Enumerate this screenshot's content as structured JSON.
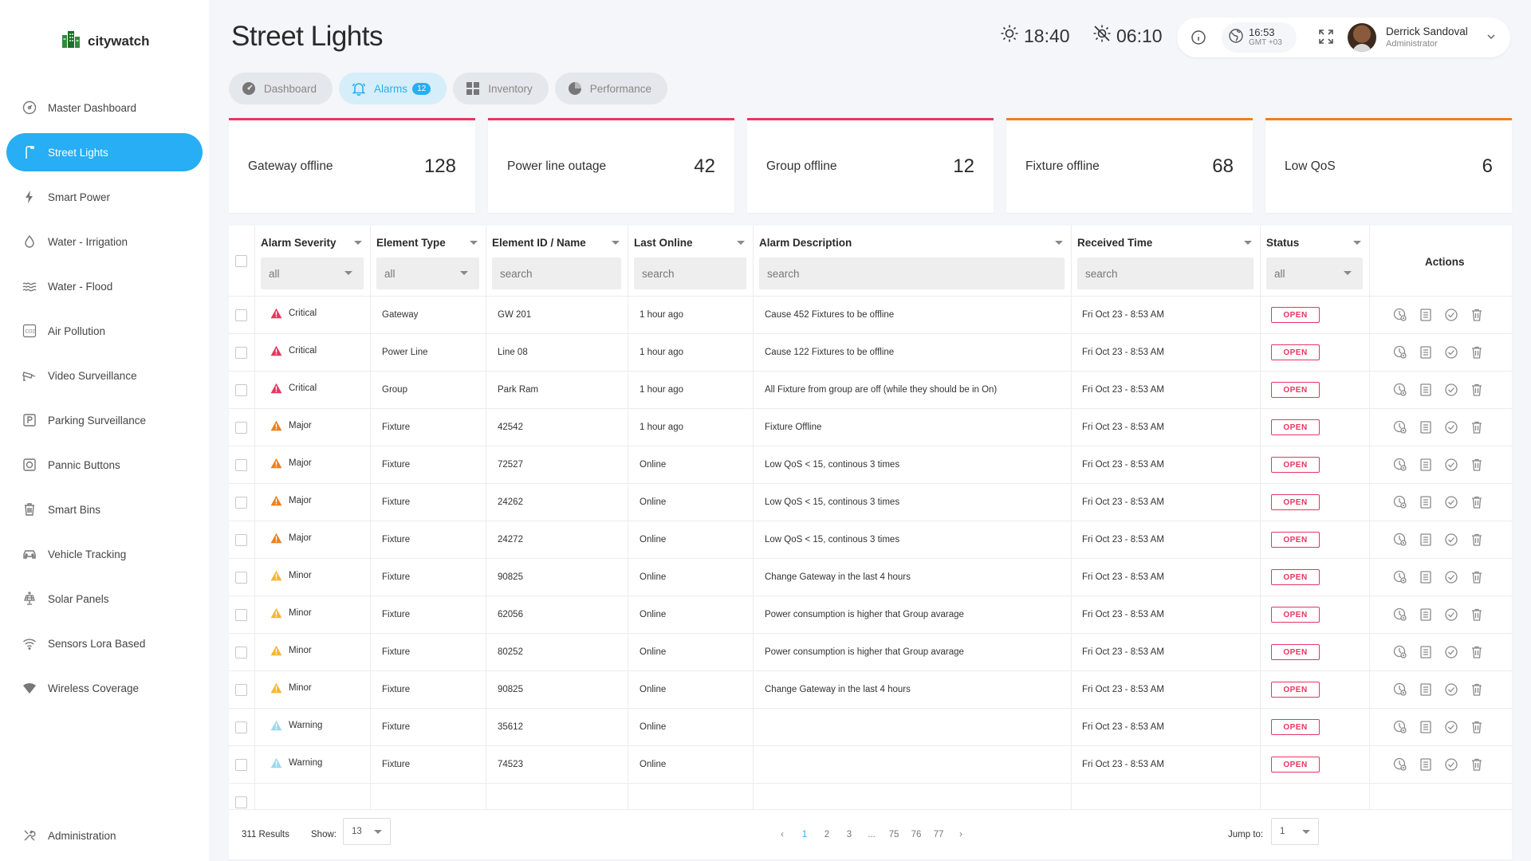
{
  "app": {
    "name": "citywatch"
  },
  "sidebar": {
    "items": [
      {
        "label": "Master Dashboard",
        "icon": "dashboard-icon",
        "active": false
      },
      {
        "label": "Street Lights",
        "icon": "street-light-icon",
        "active": true
      },
      {
        "label": "Smart Power",
        "icon": "lightning-icon",
        "active": false
      },
      {
        "label": "Water - Irrigation",
        "icon": "water-drop-icon",
        "active": false
      },
      {
        "label": "Water - Flood",
        "icon": "wave-icon",
        "active": false
      },
      {
        "label": "Air Pollution",
        "icon": "co2-icon",
        "active": false
      },
      {
        "label": "Video Surveillance",
        "icon": "camera-icon",
        "active": false
      },
      {
        "label": "Parking Surveillance",
        "icon": "parking-icon",
        "active": false
      },
      {
        "label": "Pannic Buttons",
        "icon": "panic-button-icon",
        "active": false
      },
      {
        "label": "Smart Bins",
        "icon": "bin-icon",
        "active": false
      },
      {
        "label": "Vehicle Tracking",
        "icon": "car-icon",
        "active": false
      },
      {
        "label": "Solar Panels",
        "icon": "solar-panel-icon",
        "active": false
      },
      {
        "label": "Sensors Lora Based",
        "icon": "signal-icon",
        "active": false
      },
      {
        "label": "Wireless Coverage",
        "icon": "wifi-icon",
        "active": false
      }
    ],
    "bottom": {
      "label": "Administration",
      "icon": "tools-icon"
    }
  },
  "header": {
    "title": "Street Lights",
    "sunrise": "18:40",
    "sunset": "06:10",
    "clock": {
      "time": "16:53",
      "tz": "GMT +03"
    },
    "user": {
      "name": "Derrick Sandoval",
      "role": "Administrator"
    }
  },
  "tabs": [
    {
      "label": "Dashboard",
      "icon": "gauge-icon",
      "active": false,
      "badge": ""
    },
    {
      "label": "Alarms",
      "icon": "bell-icon",
      "active": true,
      "badge": "12"
    },
    {
      "label": "Inventory",
      "icon": "grid-icon",
      "active": false,
      "badge": ""
    },
    {
      "label": "Performance",
      "icon": "pie-icon",
      "active": false,
      "badge": ""
    }
  ],
  "kpis": [
    {
      "label": "Gateway offline",
      "value": "128",
      "color": "#e8355f"
    },
    {
      "label": "Power line outage",
      "value": "42",
      "color": "#e8355f"
    },
    {
      "label": "Group offline",
      "value": "12",
      "color": "#e8355f"
    },
    {
      "label": "Fixture offline",
      "value": "68",
      "color": "#f07f1a"
    },
    {
      "label": "Low QoS",
      "value": "6",
      "color": "#f07f1a"
    }
  ],
  "table": {
    "columns": [
      {
        "label": "Alarm Severity",
        "filter": "all",
        "type": "select"
      },
      {
        "label": "Element Type",
        "filter": "all",
        "type": "select"
      },
      {
        "label": "Element ID / Name",
        "filter": "search",
        "type": "input"
      },
      {
        "label": "Last Online",
        "filter": "search",
        "type": "input"
      },
      {
        "label": "Alarm Description",
        "filter": "search",
        "type": "input"
      },
      {
        "label": "Received Time",
        "filter": "search",
        "type": "input"
      },
      {
        "label": "Status",
        "filter": "all",
        "type": "select"
      }
    ],
    "actions_label": "Actions",
    "rows": [
      {
        "severity": "Critical",
        "type": "Gateway",
        "id": "GW 201",
        "last": "1 hour ago",
        "desc": "Cause 452 Fixtures to be offline",
        "time": "Fri Oct 23 - 8:53 AM",
        "status": "OPEN"
      },
      {
        "severity": "Critical",
        "type": "Power Line",
        "id": "Line 08",
        "last": "1 hour ago",
        "desc": "Cause 122 Fixtures to be offline",
        "time": "Fri Oct 23 - 8:53 AM",
        "status": "OPEN"
      },
      {
        "severity": "Critical",
        "type": "Group",
        "id": "Park Ram",
        "last": "1 hour ago",
        "desc": "All Fixture from group are off (while they should be in On)",
        "time": "Fri Oct 23 - 8:53 AM",
        "status": "OPEN"
      },
      {
        "severity": "Major",
        "type": "Fixture",
        "id": "42542",
        "last": "1 hour ago",
        "desc": "Fixture Offline",
        "time": "Fri Oct 23 - 8:53 AM",
        "status": "OPEN"
      },
      {
        "severity": "Major",
        "type": "Fixture",
        "id": "72527",
        "last": "Online",
        "desc": "Low QoS < 15, continous 3 times",
        "time": "Fri Oct 23 - 8:53 AM",
        "status": "OPEN"
      },
      {
        "severity": "Major",
        "type": "Fixture",
        "id": "24262",
        "last": "Online",
        "desc": "Low QoS < 15, continous 3 times",
        "time": "Fri Oct 23 - 8:53 AM",
        "status": "OPEN"
      },
      {
        "severity": "Major",
        "type": "Fixture",
        "id": "24272",
        "last": "Online",
        "desc": "Low QoS < 15, continous 3 times",
        "time": "Fri Oct 23 - 8:53 AM",
        "status": "OPEN"
      },
      {
        "severity": "Minor",
        "type": "Fixture",
        "id": "90825",
        "last": "Online",
        "desc": "Change Gateway in the last 4 hours",
        "time": "Fri Oct 23 - 8:53 AM",
        "status": "OPEN"
      },
      {
        "severity": "Minor",
        "type": "Fixture",
        "id": "62056",
        "last": "Online",
        "desc": "Power consumption is higher that Group avarage",
        "time": "Fri Oct 23 - 8:53 AM",
        "status": "OPEN"
      },
      {
        "severity": "Minor",
        "type": "Fixture",
        "id": "80252",
        "last": "Online",
        "desc": "Power consumption is higher that Group avarage",
        "time": "Fri Oct 23 - 8:53 AM",
        "status": "OPEN"
      },
      {
        "severity": "Minor",
        "type": "Fixture",
        "id": "90825",
        "last": "Online",
        "desc": "Change Gateway in the last 4 hours",
        "time": "Fri Oct 23 - 8:53 AM",
        "status": "OPEN"
      },
      {
        "severity": "Warning",
        "type": "Fixture",
        "id": "35612",
        "last": "Online",
        "desc": "",
        "time": "Fri Oct 23 - 8:53 AM",
        "status": "OPEN"
      },
      {
        "severity": "Warning",
        "type": "Fixture",
        "id": "74523",
        "last": "Online",
        "desc": "",
        "time": "Fri Oct 23 - 8:53 AM",
        "status": "OPEN"
      }
    ],
    "severity_colors": {
      "Critical": "#e8355f",
      "Major": "#f07f1a",
      "Minor": "#f5b731",
      "Warning": "#9fd8ee"
    },
    "status_color": "#e8355f"
  },
  "footer": {
    "results": "311 Results",
    "show_label": "Show:",
    "show_value": "13",
    "pages": [
      "1",
      "2",
      "3",
      "...",
      "75",
      "76",
      "77"
    ],
    "current_page": "1",
    "prev": "‹",
    "next": "›",
    "jump_label": "Jump to:",
    "jump_value": "1"
  },
  "colors": {
    "accent": "#27aef4",
    "critical": "#e8355f",
    "warning_orange": "#f07f1a"
  }
}
